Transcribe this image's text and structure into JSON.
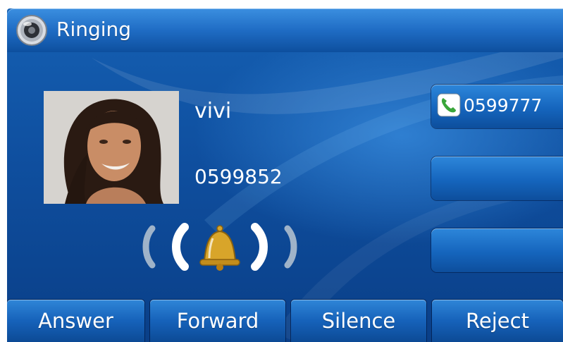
{
  "header": {
    "title": "Ringing",
    "icon": "speaker-icon"
  },
  "caller": {
    "name": "vivi",
    "number": "0599852",
    "photo": "contact-photo"
  },
  "ring_indicator": {
    "icon": "bell-icon"
  },
  "line_keys": [
    {
      "label": "0599777",
      "icon": "phone-handset-icon"
    },
    {
      "label": ""
    },
    {
      "label": ""
    }
  ],
  "softkeys": {
    "answer": "Answer",
    "forward": "Forward",
    "silence": "Silence",
    "reject": "Reject"
  },
  "colors": {
    "background": "#0f4f9f",
    "title_bar": "#1f6cc4",
    "button": "#1662ba",
    "text": "#ffffff",
    "line_icon": "#3aa63a",
    "bell": "#d8a52a"
  }
}
